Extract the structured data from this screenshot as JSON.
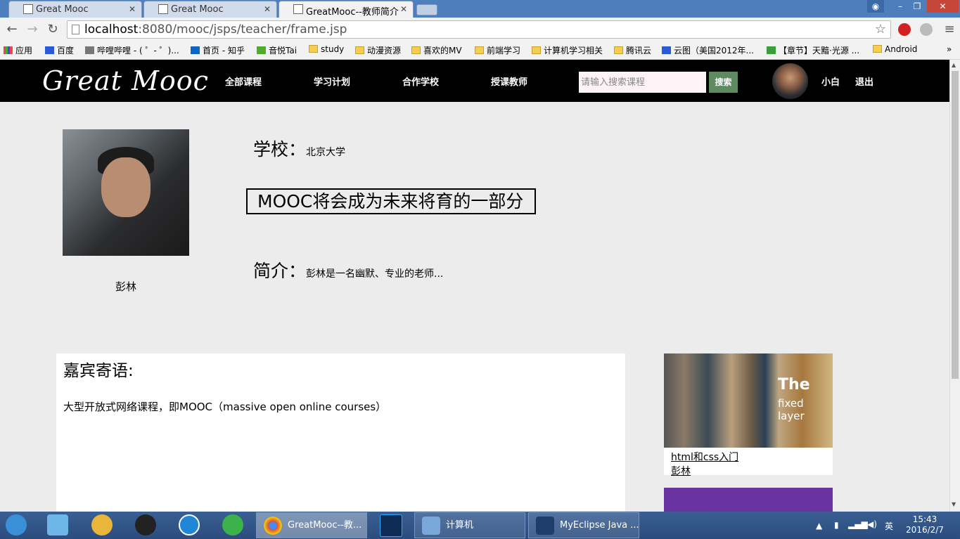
{
  "browser": {
    "tabs": [
      {
        "label": "Great Mooc"
      },
      {
        "label": "Great Mooc"
      },
      {
        "label": "GreatMooc--教师简介"
      }
    ],
    "url": {
      "host": "localhost",
      "rest": ":8080/mooc/jsps/teacher/frame.jsp"
    },
    "bookmarks": [
      "应用",
      "百度",
      "哔哩哔哩 - ( ゜- ゜)...",
      "首页 - 知乎",
      "音悦Tai",
      "study",
      "动漫资源",
      "喜欢的MV",
      "前端学习",
      "计算机学习相关",
      "腾讯云",
      "云图（美国2012年...",
      "【章节】天黯·光源 ...",
      "Android"
    ],
    "overflow": "»"
  },
  "site": {
    "logo": "Great Mooc",
    "nav": [
      "全部课程",
      "学习计划",
      "合作学校",
      "授课教师"
    ],
    "search": {
      "placeholder": "请输入搜索课程",
      "button": "搜索"
    },
    "user": {
      "name": "小白",
      "logout": "退出"
    }
  },
  "teacher": {
    "name": "彭林",
    "school_label": "学校：",
    "school_value": "北京大学",
    "motto": "MOOC将会成为未来将育的一部分",
    "intro_label": "简介：",
    "intro_value": "彭林是一名幽默、专业的老师..."
  },
  "guest": {
    "title": "嘉宾寄语:",
    "text": "大型开放式网络课程，即MOOC（massive open online courses）"
  },
  "course": {
    "image_text1": "The",
    "image_text2": "fixed layer",
    "name": "html和css入门",
    "teacher": "彭林"
  },
  "taskbar": {
    "tasks": [
      "GreatMooc--教...",
      "计算机",
      "MyEclipse Java ..."
    ],
    "ime": "英",
    "time": "15:43",
    "date": "2016/2/7"
  }
}
